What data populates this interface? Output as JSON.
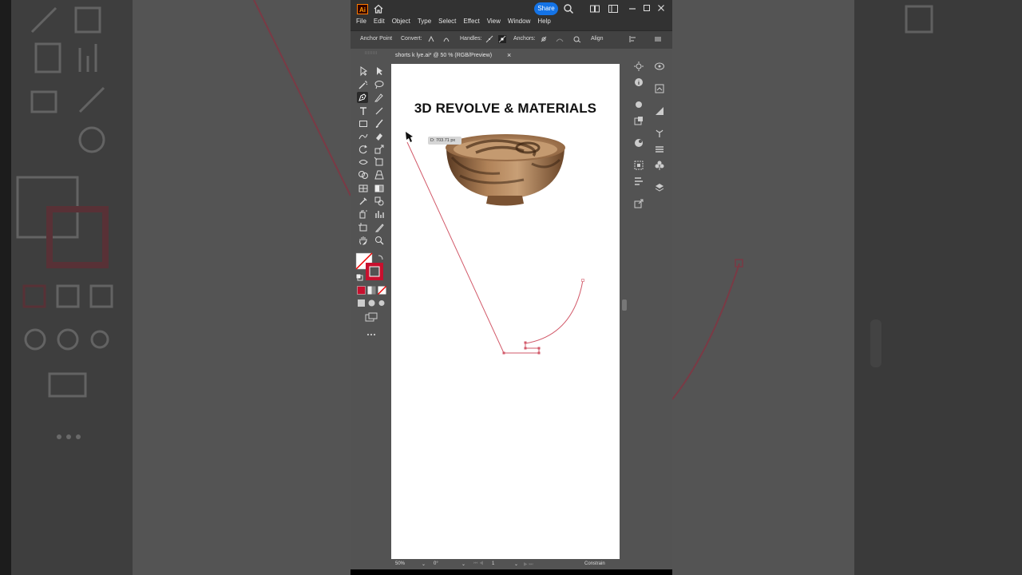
{
  "app": {
    "logo_text": "Ai",
    "share_label": "Share",
    "menus": [
      "File",
      "Edit",
      "Object",
      "Type",
      "Select",
      "Effect",
      "View",
      "Window",
      "Help"
    ]
  },
  "control_bar": {
    "anchor_point_label": "Anchor Point",
    "convert_label": "Convert:",
    "handles_label": "Handles:",
    "anchors_label": "Anchors:",
    "align_label": "Align"
  },
  "document": {
    "tab_title": "shorts k lye.ai* @ 50 % (RGB/Preview)",
    "close_glyph": "×"
  },
  "artboard": {
    "heading": "3D REVOLVE & MATERIALS",
    "distance_tip": "D: 703.71 px",
    "path_color": "#d25a6a"
  },
  "status_bar": {
    "zoom": "50%",
    "rotation": "0°",
    "artboard_number": "1",
    "mode": "Constrain"
  },
  "colors": {
    "stroke_swatch": "#c8102e",
    "accent": "#1473e6"
  }
}
